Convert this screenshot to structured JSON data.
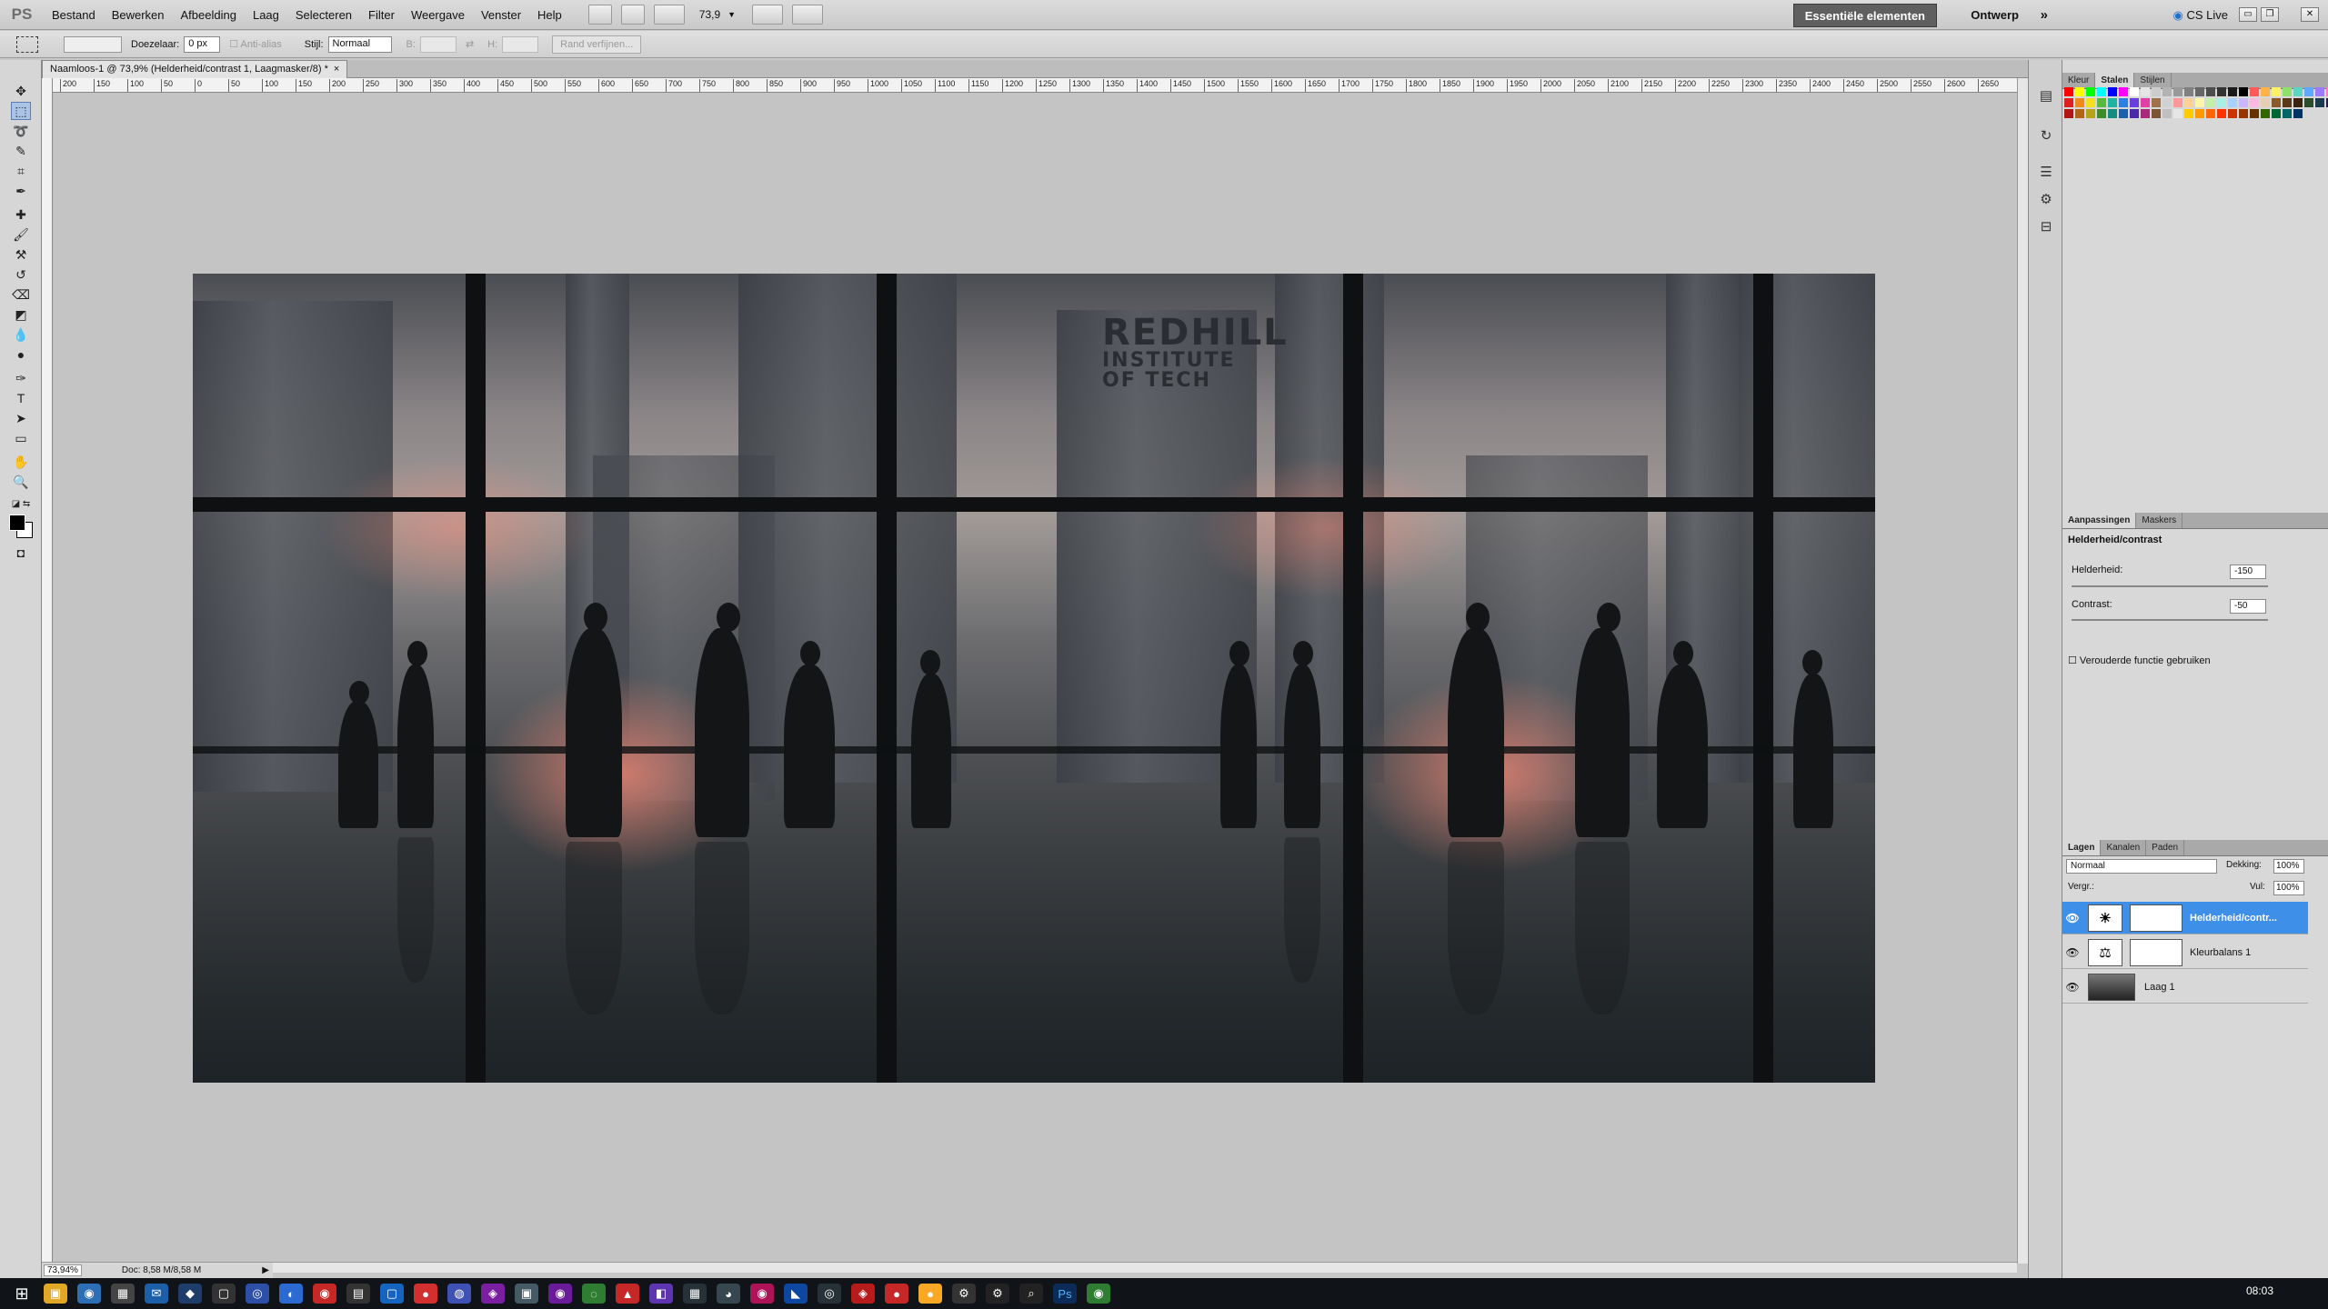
{
  "app": {
    "logo": "PS"
  },
  "menu": [
    "Bestand",
    "Bewerken",
    "Afbeelding",
    "Laag",
    "Selecteren",
    "Filter",
    "Weergave",
    "Venster",
    "Help"
  ],
  "zoom_menu": "73,9",
  "workspace": {
    "active": "Essentiële elementen",
    "other": "Ontwerp",
    "more": "»",
    "cs_live": "CS Live"
  },
  "window_buttons": [
    "▭",
    "❐",
    "✕"
  ],
  "options": {
    "doezelaar_label": "Doezelaar:",
    "doezelaar_value": "0 px",
    "anti_alias": "Anti-alias",
    "stijl_label": "Stijl:",
    "stijl_value": "Normaal",
    "b_label": "B:",
    "h_label": "H:",
    "refine_button": "Rand verfijnen..."
  },
  "document": {
    "tab_title": "Naamloos-1 @ 73,9% (Helderheid/contrast 1, Laagmasker/8) *",
    "close": "×",
    "zoom_status": "73,94%",
    "doc_status": "Doc: 8,58 M/8,58 M",
    "image_text": [
      "REDHILL",
      "INSTITUTE",
      "OF TECH"
    ]
  },
  "ruler_ticks": [
    "200",
    "150",
    "100",
    "50",
    "0",
    "50",
    "100",
    "150",
    "200",
    "250",
    "300",
    "350",
    "400",
    "450",
    "500",
    "550",
    "600",
    "650",
    "700",
    "750",
    "800",
    "850",
    "900",
    "950",
    "1000",
    "1050",
    "1100",
    "1150",
    "1200",
    "1250",
    "1300",
    "1350",
    "1400",
    "1450",
    "1500",
    "1550",
    "1600",
    "1650",
    "1700",
    "1750",
    "1800",
    "1850",
    "1900",
    "1950",
    "2000",
    "2050",
    "2100",
    "2150",
    "2200",
    "2250",
    "2300",
    "2350",
    "2400",
    "2450",
    "2500",
    "2550",
    "2600",
    "2650"
  ],
  "panels": {
    "color_tabs": [
      "Kleur",
      "Stalen",
      "Stijlen"
    ],
    "adjust_tabs": [
      "Aanpassingen",
      "Maskers"
    ],
    "adjust_title": "Helderheid/contrast",
    "brightness_label": "Helderheid:",
    "brightness_value": "-150",
    "contrast_label": "Contrast:",
    "contrast_value": "-50",
    "legacy_label": "Verouderde functie gebruiken",
    "layer_tabs": [
      "Lagen",
      "Kanalen",
      "Paden"
    ],
    "blend_mode": "Normaal",
    "opacity_label": "Dekking:",
    "opacity_value": "100%",
    "lock_label": "Vergr.:",
    "fill_label": "Vul:",
    "fill_value": "100%",
    "layers": [
      {
        "name": "Helderheid/contr...",
        "icon": "☀",
        "selected": true
      },
      {
        "name": "Kleurbalans 1",
        "icon": "⚖",
        "selected": false
      },
      {
        "name": "Laag 1",
        "icon": "",
        "selected": false
      }
    ]
  },
  "swatch_colors": [
    "#ff0000",
    "#ffff00",
    "#00ff00",
    "#00ffff",
    "#0000ff",
    "#ff00ff",
    "#ffffff",
    "#e6e6e6",
    "#cccccc",
    "#b3b3b3",
    "#999999",
    "#808080",
    "#666666",
    "#4d4d4d",
    "#333333",
    "#1a1a1a",
    "#000000",
    "#ff5a5a",
    "#ffb347",
    "#fff06a",
    "#8ee26b",
    "#5fd3c4",
    "#5ea8ff",
    "#9b7bff",
    "#ff7ac8",
    "#c7a37a",
    "#e02020",
    "#f08a1c",
    "#f5e11b",
    "#59b93b",
    "#1fb3a3",
    "#2d7fe0",
    "#6a3fe0",
    "#e03fa5",
    "#a0724a",
    "#d1d1d1",
    "#ff9999",
    "#ffd199",
    "#fff5a8",
    "#c2f0a8",
    "#a8f0e6",
    "#a8d1ff",
    "#c9b8ff",
    "#ffb8e0",
    "#e6cfb3",
    "#8a5a2b",
    "#5b3a1a",
    "#3a230f",
    "#2a4d2a",
    "#1a3a4d",
    "#2a1a4d",
    "#4d1a3a",
    "#b31515",
    "#b36515",
    "#b3a515",
    "#3d8c27",
    "#158c80",
    "#1f5ea8",
    "#4a2aa8",
    "#a82a78",
    "#7a5433",
    "#c0c0c0",
    "#e6e6e6",
    "#ffcc00",
    "#ff9900",
    "#ff6600",
    "#ff3300",
    "#cc3300",
    "#993300",
    "#663300",
    "#336600",
    "#006633",
    "#006666",
    "#003366"
  ]
}
